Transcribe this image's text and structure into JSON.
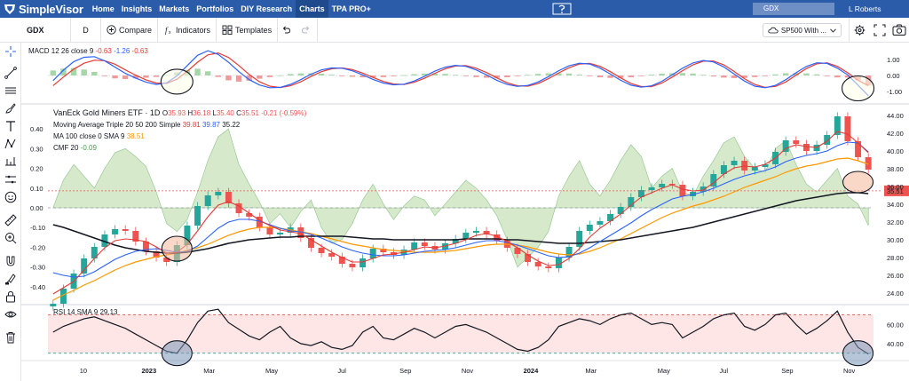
{
  "nav": {
    "brand": "SimpleVisor",
    "items": [
      "Home",
      "Insights",
      "Markets",
      "Portfolios",
      "DIY Research",
      "Charts",
      "TPA PRO+"
    ],
    "active": "Charts",
    "search_value": "GDX",
    "user": "L Roberts"
  },
  "toolbar": {
    "symbol": "GDX",
    "interval": "D",
    "compare": "Compare",
    "indicators": "Indicators",
    "templates": "Templates",
    "compare_select": "SP500 With ..."
  },
  "legend": {
    "title": "VanEck Gold Miners ETF · 1D",
    "ohlc": [
      {
        "label": "O",
        "value": "35.93"
      },
      {
        "label": "H",
        "value": "36.18"
      },
      {
        "label": "L",
        "value": "35.40"
      },
      {
        "label": "C",
        "value": "35.51"
      }
    ],
    "change": "-0.21 (-0.59%)",
    "ma_label": "Moving Average Triple 20 50 200 Simple",
    "ma_values": [
      "39.81",
      "39.87",
      "35.22"
    ],
    "sma_label": "MA 100 close 0 SMA 9",
    "sma_value": "38.51",
    "cmf_label": "CMF 20",
    "cmf_value": "-0.09",
    "macd_label": "MACD 12 26 close 9",
    "macd_values": [
      "-0.63",
      "-1.26",
      "-0.63"
    ],
    "rsi_label": "RSI 14 SMA 9",
    "rsi_value": "29.13"
  },
  "colors": {
    "up": "#26a69a",
    "down": "#ef5350",
    "ma20": "#e53935",
    "ma50": "#2962ff",
    "ma200": "#131722",
    "sma100": "#ff9800",
    "cmf": "#b7d7a0",
    "rsi": "#131722",
    "macd": "#2962ff",
    "signal": "#e53935",
    "price_tag": "#ef5350"
  },
  "chart_data": [
    {
      "type": "line",
      "name": "price",
      "x_ticks": [
        "10",
        "2023",
        "Mar",
        "May",
        "Jul",
        "Sep",
        "Nov",
        "2024",
        "Mar",
        "May",
        "Jul",
        "Sep",
        "Nov"
      ],
      "y_ticks": [
        "44.00",
        "42.00",
        "40.00",
        "38.00",
        "36.00",
        "34.00",
        "32.00",
        "30.00",
        "28.00",
        "26.00",
        "24.00"
      ],
      "ylim": [
        23,
        45
      ],
      "cmf_ticks": [
        "0.40",
        "0.30",
        "0.20",
        "0.10",
        "0.00",
        "-0.10",
        "-0.20",
        "-0.30",
        "-0.40"
      ],
      "cmf_lim": [
        -0.45,
        0.45
      ],
      "last_price": "35.51",
      "close": [
        22.8,
        24.5,
        26.2,
        27.9,
        29.2,
        30.6,
        31.2,
        31.0,
        29.8,
        28.7,
        28.0,
        27.5,
        29.4,
        31.6,
        33.8,
        35.0,
        35.4,
        34.1,
        33.0,
        32.6,
        31.4,
        30.6,
        30.8,
        31.4,
        30.2,
        29.1,
        28.5,
        28.1,
        27.3,
        26.9,
        27.9,
        29.0,
        28.6,
        28.3,
        28.9,
        29.7,
        29.3,
        28.9,
        29.6,
        30.1,
        30.8,
        31.0,
        30.6,
        29.9,
        29.1,
        28.4,
        27.5,
        27.0,
        26.8,
        28.0,
        29.2,
        31.0,
        31.7,
        32.1,
        32.9,
        33.7,
        34.8,
        35.6,
        35.9,
        36.3,
        36.2,
        34.9,
        35.4,
        36.0,
        37.4,
        38.4,
        38.9,
        37.8,
        38.2,
        38.5,
        39.9,
        41.2,
        40.8,
        40.0,
        40.7,
        41.8,
        43.9,
        41.1,
        39.3,
        37.9
      ],
      "ma20": [
        23.9,
        24.6,
        25.3,
        26.6,
        27.9,
        29.1,
        29.9,
        30.1,
        30.0,
        29.8,
        29.2,
        28.5,
        28.6,
        29.5,
        31.0,
        32.6,
        33.9,
        34.3,
        33.8,
        33.0,
        32.2,
        31.6,
        31.1,
        30.9,
        30.7,
        30.0,
        29.3,
        28.6,
        28.0,
        27.5,
        27.5,
        27.9,
        28.3,
        28.4,
        28.6,
        28.9,
        29.2,
        29.1,
        29.3,
        29.6,
        30.0,
        30.5,
        30.7,
        30.4,
        29.8,
        29.1,
        28.3,
        27.6,
        27.1,
        27.2,
        27.9,
        29.0,
        30.3,
        31.3,
        32.1,
        32.9,
        33.9,
        34.8,
        35.3,
        35.8,
        36.2,
        35.7,
        35.5,
        35.6,
        36.4,
        37.4,
        38.1,
        38.3,
        38.2,
        38.5,
        39.2,
        40.3,
        40.7,
        40.5,
        40.4,
        41.1,
        42.2,
        41.9,
        40.9,
        39.8
      ],
      "ma50": [
        26.3,
        26.0,
        25.8,
        25.9,
        26.4,
        27.1,
        27.8,
        28.3,
        28.7,
        28.9,
        29.0,
        28.8,
        28.6,
        28.7,
        29.3,
        30.3,
        31.3,
        32.0,
        32.3,
        32.3,
        32.1,
        31.7,
        31.3,
        31.0,
        30.9,
        30.6,
        30.2,
        29.7,
        29.2,
        28.8,
        28.5,
        28.3,
        28.2,
        28.2,
        28.3,
        28.5,
        28.7,
        28.8,
        28.9,
        29.1,
        29.4,
        29.7,
        29.9,
        29.9,
        29.7,
        29.4,
        29.0,
        28.6,
        28.2,
        28.0,
        28.1,
        28.5,
        29.1,
        29.8,
        30.5,
        31.2,
        31.9,
        32.7,
        33.4,
        34.0,
        34.6,
        34.9,
        35.1,
        35.4,
        35.8,
        36.3,
        36.8,
        37.2,
        37.5,
        37.8,
        38.2,
        38.8,
        39.2,
        39.5,
        39.7,
        40.0,
        40.6,
        41.0,
        40.9,
        39.9
      ],
      "ma200": [
        31.7,
        31.4,
        31.0,
        30.6,
        30.2,
        29.8,
        29.4,
        29.1,
        28.9,
        28.7,
        28.6,
        28.5,
        28.5,
        28.6,
        28.8,
        29.0,
        29.3,
        29.6,
        29.8,
        30.0,
        30.1,
        30.2,
        30.3,
        30.3,
        30.4,
        30.4,
        30.4,
        30.4,
        30.4,
        30.3,
        30.2,
        30.1,
        30.1,
        30.0,
        30.0,
        30.0,
        30.0,
        30.0,
        30.0,
        30.0,
        30.1,
        30.1,
        30.1,
        30.1,
        30.0,
        30.0,
        29.9,
        29.8,
        29.7,
        29.6,
        29.6,
        29.6,
        29.7,
        29.8,
        29.9,
        30.0,
        30.2,
        30.4,
        30.6,
        30.8,
        31.0,
        31.2,
        31.4,
        31.7,
        32.0,
        32.3,
        32.6,
        32.9,
        33.2,
        33.5,
        33.8,
        34.1,
        34.4,
        34.6,
        34.8,
        35.0,
        35.2,
        35.3,
        35.3,
        35.2
      ],
      "sma100": [
        23.2,
        23.8,
        24.3,
        24.9,
        25.4,
        26.0,
        26.6,
        27.1,
        27.5,
        27.8,
        28.1,
        28.3,
        28.5,
        28.8,
        29.1,
        29.5,
        30.0,
        30.5,
        30.9,
        31.2,
        31.4,
        31.4,
        31.3,
        31.1,
        30.9,
        30.7,
        30.4,
        30.1,
        29.8,
        29.5,
        29.3,
        29.1,
        28.9,
        28.8,
        28.7,
        28.6,
        28.6,
        28.6,
        28.7,
        28.8,
        29.0,
        29.2,
        29.4,
        29.5,
        29.5,
        29.4,
        29.2,
        28.9,
        28.6,
        28.4,
        28.3,
        28.4,
        28.7,
        29.1,
        29.6,
        30.1,
        30.7,
        31.3,
        31.9,
        32.5,
        33.0,
        33.4,
        33.8,
        34.1,
        34.5,
        34.9,
        35.4,
        35.9,
        36.3,
        36.7,
        37.1,
        37.6,
        38.0,
        38.3,
        38.5,
        38.8,
        39.1,
        39.2,
        38.9,
        38.5
      ],
      "cmf": [
        0.0,
        0.14,
        0.22,
        0.16,
        0.1,
        0.2,
        0.28,
        0.3,
        0.26,
        0.21,
        0.08,
        -0.08,
        -0.12,
        -0.06,
        0.08,
        0.24,
        0.36,
        0.4,
        0.22,
        0.12,
        0.03,
        -0.08,
        -0.03,
        -0.1,
        -0.02,
        0.04,
        -0.1,
        -0.18,
        -0.16,
        -0.08,
        0.04,
        0.12,
        0.02,
        -0.06,
        0.01,
        0.06,
        0.04,
        -0.04,
        0.02,
        0.08,
        0.14,
        0.1,
        0.04,
        -0.04,
        -0.16,
        -0.3,
        -0.25,
        -0.2,
        -0.12,
        0.06,
        0.16,
        0.24,
        0.12,
        0.06,
        0.14,
        0.24,
        0.32,
        0.26,
        0.1,
        0.16,
        0.2,
        0.08,
        0.06,
        0.16,
        0.24,
        0.33,
        0.36,
        0.26,
        0.2,
        0.18,
        0.3,
        0.34,
        0.22,
        0.12,
        0.08,
        0.14,
        0.2,
        0.06,
        0.02,
        -0.09
      ]
    },
    {
      "type": "line",
      "name": "MACD",
      "y_ticks": [
        "1.00",
        "0.00",
        "-1.00"
      ],
      "ylim": [
        -1.6,
        1.6
      ],
      "macd": [
        -0.32,
        0.33,
        0.86,
        1.13,
        1.17,
        0.91,
        0.52,
        0.13,
        -0.16,
        -0.41,
        -0.56,
        -0.46,
        -0.03,
        0.61,
        1.25,
        1.54,
        1.31,
        0.82,
        0.24,
        -0.26,
        -0.59,
        -0.76,
        -0.74,
        -0.55,
        -0.26,
        0.08,
        0.35,
        0.47,
        0.45,
        0.29,
        0.04,
        -0.24,
        -0.47,
        -0.58,
        -0.54,
        -0.34,
        -0.05,
        0.27,
        0.52,
        0.63,
        0.57,
        0.35,
        0.04,
        -0.3,
        -0.56,
        -0.68,
        -0.62,
        -0.4,
        -0.07,
        0.3,
        0.6,
        0.76,
        0.71,
        0.46,
        0.09,
        -0.3,
        -0.6,
        -0.73,
        -0.64,
        -0.36,
        0.04,
        0.45,
        0.78,
        0.93,
        0.84,
        0.53,
        0.09,
        -0.35,
        -0.66,
        -0.76,
        -0.61,
        -0.26,
        0.17,
        0.56,
        0.79,
        0.75,
        0.45,
        0.04,
        -0.6,
        -1.26
      ],
      "signal": [
        -0.63,
        -0.1,
        0.4,
        0.76,
        0.95,
        0.92,
        0.7,
        0.35,
        0.02,
        -0.27,
        -0.47,
        -0.49,
        -0.23,
        0.26,
        0.83,
        1.28,
        1.4,
        1.12,
        0.62,
        0.06,
        -0.39,
        -0.66,
        -0.75,
        -0.64,
        -0.39,
        -0.06,
        0.24,
        0.42,
        0.47,
        0.37,
        0.15,
        -0.12,
        -0.37,
        -0.53,
        -0.56,
        -0.42,
        -0.17,
        0.14,
        0.42,
        0.59,
        0.61,
        0.45,
        0.18,
        -0.15,
        -0.45,
        -0.64,
        -0.66,
        -0.5,
        -0.2,
        0.16,
        0.48,
        0.71,
        0.75,
        0.57,
        0.24,
        -0.15,
        -0.49,
        -0.69,
        -0.69,
        -0.47,
        -0.1,
        0.3,
        0.66,
        0.89,
        0.9,
        0.66,
        0.25,
        -0.2,
        -0.56,
        -0.74,
        -0.68,
        -0.4,
        0.02,
        0.43,
        0.72,
        0.79,
        0.57,
        0.17,
        -0.3,
        -0.63
      ]
    },
    {
      "type": "line",
      "name": "RSI",
      "y_ticks": [
        "60.00",
        "40.00"
      ],
      "ylim": [
        26,
        78
      ],
      "upper_band": 70,
      "lower_band": 30,
      "rsi": [
        52,
        58,
        62,
        66,
        68,
        64,
        60,
        56,
        50,
        44,
        38,
        32,
        30,
        44,
        62,
        74,
        76,
        62,
        55,
        48,
        44,
        52,
        58,
        46,
        40,
        38,
        42,
        36,
        34,
        38,
        52,
        58,
        46,
        44,
        50,
        56,
        52,
        46,
        52,
        58,
        60,
        56,
        52,
        46,
        40,
        34,
        32,
        36,
        44,
        58,
        62,
        66,
        64,
        60,
        66,
        70,
        72,
        66,
        60,
        62,
        60,
        46,
        52,
        58,
        66,
        70,
        72,
        58,
        54,
        60,
        70,
        72,
        60,
        50,
        56,
        64,
        74,
        52,
        36,
        29.13
      ]
    }
  ]
}
